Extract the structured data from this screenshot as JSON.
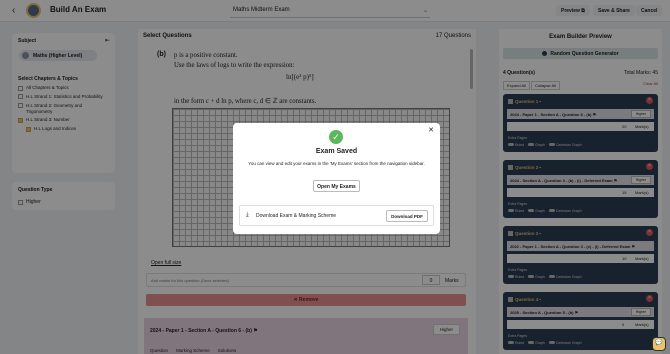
{
  "header": {
    "title": "Build An Exam",
    "exam_name": "Maths Midterm Exam",
    "preview": "Preview",
    "save_share": "Save & Share",
    "cancel": "Cancel"
  },
  "sidebar": {
    "subject_heading": "Subject",
    "subject": "Maths (Higher Level)",
    "chapters_heading": "Select Chapters & Topics",
    "items": [
      {
        "label": "All Chapters & Topics",
        "checked": false,
        "indent": 0
      },
      {
        "label": "H.L Strand 1: Statistics and Probability",
        "checked": false,
        "indent": 0
      },
      {
        "label": "H.L Strand 2: Geometry and Trigonometry",
        "checked": false,
        "indent": 0
      },
      {
        "label": "H.L Strand 3: Number",
        "checked": true,
        "indent": 0
      },
      {
        "label": "H.L Logs and Indices",
        "checked": true,
        "indent": 1
      }
    ],
    "qtype_heading": "Question Type",
    "qtype_option": "Higher"
  },
  "center": {
    "heading": "Select Questions",
    "count": "17 Questions",
    "question_letter": "(b)",
    "line1": "p is a positive constant.",
    "line2": "Use the laws of logs to write the expression:",
    "equation": "ln[(e³ p)⁵]",
    "line3": "in the form  c + d ln p,  where c, d ∈ ℤ are constants.",
    "open_full": "Open full size",
    "marks_placeholder": "Add marks for this question (Once selected)",
    "marks_value": "0",
    "marks_label": "Marks",
    "remove": "✕ Remove",
    "next_title": "2024 - Paper 1 - Section A - Question 6 - (b)",
    "next_level": "Higher",
    "tabs": [
      "Question",
      "Marking Scheme",
      "Solutions"
    ]
  },
  "right": {
    "heading": "Exam Builder Preview",
    "generator": "Random Question Generator",
    "questions": "4 Question(s)",
    "total_marks": "Total Marks: 45",
    "expand": "Expand All",
    "collapse": "Collapse All",
    "clear": "Clear All",
    "extra_pages": "Extra Pages",
    "toggles": [
      "Ruled",
      "Graph",
      "Cartesian Graph"
    ],
    "level": "Higher",
    "marks_suffix": "Mark(s)",
    "cards": [
      {
        "label": "Question 1",
        "title": "2024 - Paper 1 - Section A - Question 6 - (b)",
        "marks": "20"
      },
      {
        "label": "Question 2",
        "title": "2024 - Section A - Question 3 - (b) - (i) - Deferred Exam",
        "marks": "15"
      },
      {
        "label": "Question 3",
        "title": "2022 - Paper 1 - Section A - Question 3 - (c) - (i) - Deferred Exam",
        "marks": "10"
      },
      {
        "label": "Question 4",
        "title": "2025 - Section A - Question 5 - (b)",
        "marks": "0"
      }
    ]
  },
  "modal": {
    "title": "Exam Saved",
    "message": "You can view and edit your exams in the 'My Exams' section from the navigation sidebar.",
    "open_button": "Open My Exams",
    "download_text": "Download Exam & Marking Scheme",
    "download_button": "Download PDF"
  }
}
